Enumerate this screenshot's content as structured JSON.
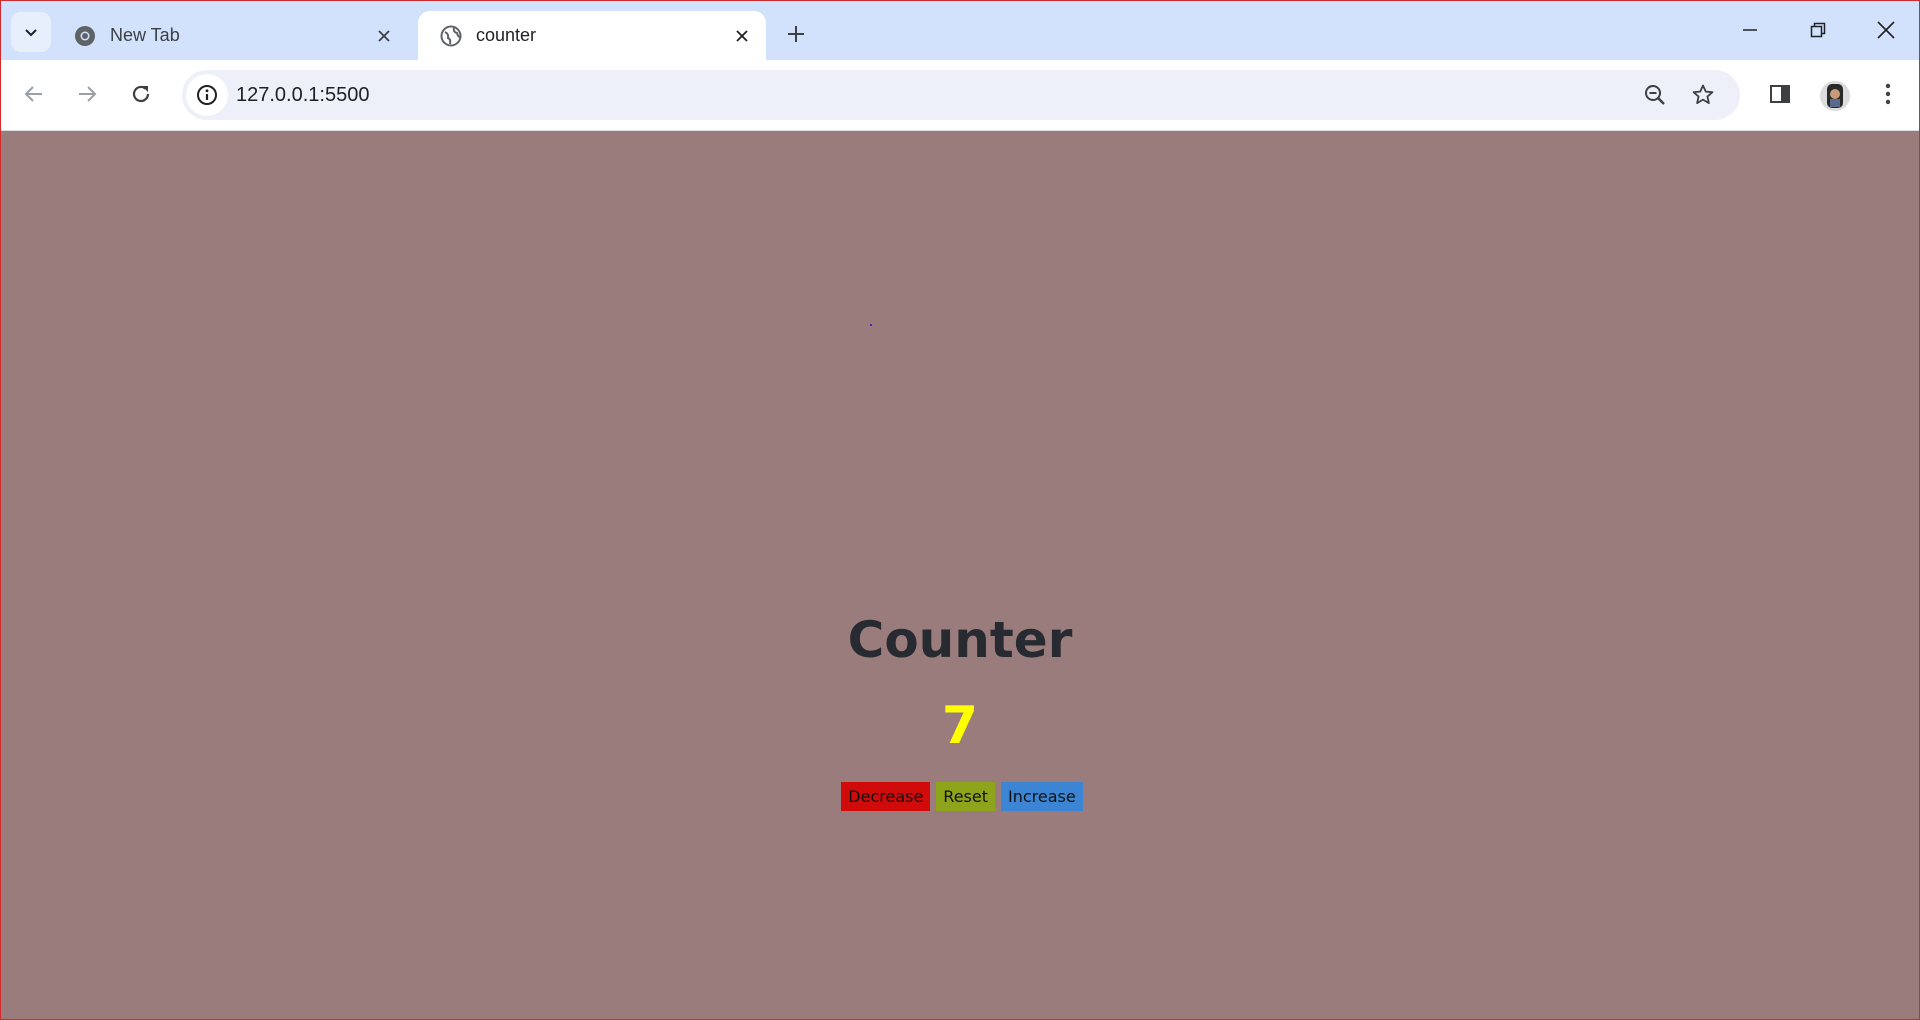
{
  "browser": {
    "tabs": [
      {
        "title": "New Tab",
        "icon": "chrome-icon",
        "active": false
      },
      {
        "title": "counter",
        "icon": "globe-icon",
        "active": true
      }
    ],
    "address": "127.0.0.1:5500"
  },
  "page": {
    "title": "Counter",
    "count": "7",
    "buttons": {
      "decrease": "Decrease",
      "reset": "Reset",
      "increase": "Increase"
    }
  },
  "colors": {
    "page_background": "#9a7c7c",
    "count_color": "#ffff00",
    "decrease_bg": "#d10a0a",
    "reset_bg": "#8ea41a",
    "increase_bg": "#3c85d4"
  }
}
